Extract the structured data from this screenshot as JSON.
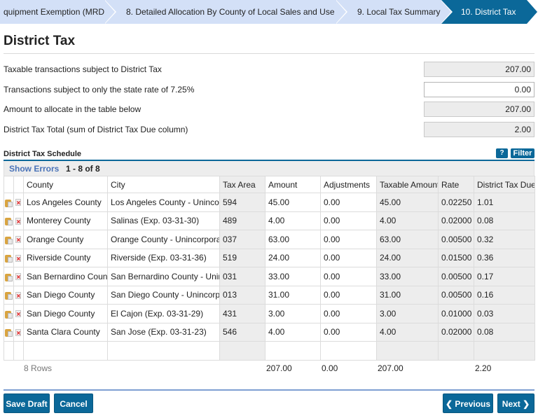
{
  "wizard": {
    "steps": [
      {
        "label": "quipment Exemption (MRD)",
        "active": false
      },
      {
        "label": "8. Detailed Allocation By County of Local Sales and Use Tax",
        "active": false
      },
      {
        "label": "9. Local Tax Summary",
        "active": false
      },
      {
        "label": "10. District Tax",
        "active": true
      }
    ]
  },
  "page": {
    "title": "District Tax"
  },
  "fields": [
    {
      "label": "Taxable transactions subject to District Tax",
      "value": "207.00",
      "editable": false
    },
    {
      "label": "Transactions subject to only the state rate of 7.25%",
      "value": "0.00",
      "editable": true
    },
    {
      "label": "Amount to allocate in the table below",
      "value": "207.00",
      "editable": false
    },
    {
      "label": "District Tax Total (sum of District Tax Due column)",
      "value": "2.00",
      "editable": false
    }
  ],
  "schedule": {
    "title": "District Tax Schedule",
    "help_label": "?",
    "filter_label": "Filter",
    "show_errors_label": "Show Errors",
    "paging": "1 - 8 of 8",
    "columns": [
      "County",
      "City",
      "Tax Area",
      "Amount",
      "Adjustments",
      "Taxable Amount",
      "Rate",
      "District Tax Due"
    ],
    "rows": [
      {
        "county": "Los Angeles County",
        "city": "Los Angeles County - Unincorpo",
        "tax_area": "594",
        "amount": "45.00",
        "adjustments": "0.00",
        "taxable_amount": "45.00",
        "rate": "0.02250",
        "due": "1.01"
      },
      {
        "county": "Monterey County",
        "city": "Salinas (Exp. 03-31-30)",
        "tax_area": "489",
        "amount": "4.00",
        "adjustments": "0.00",
        "taxable_amount": "4.00",
        "rate": "0.02000",
        "due": "0.08"
      },
      {
        "county": "Orange County",
        "city": "Orange County - Unincorporate",
        "tax_area": "037",
        "amount": "63.00",
        "adjustments": "0.00",
        "taxable_amount": "63.00",
        "rate": "0.00500",
        "due": "0.32"
      },
      {
        "county": "Riverside County",
        "city": "Riverside (Exp. 03-31-36)",
        "tax_area": "519",
        "amount": "24.00",
        "adjustments": "0.00",
        "taxable_amount": "24.00",
        "rate": "0.01500",
        "due": "0.36"
      },
      {
        "county": "San Bernardino County",
        "city": "San Bernardino County - Uninco",
        "tax_area": "031",
        "amount": "33.00",
        "adjustments": "0.00",
        "taxable_amount": "33.00",
        "rate": "0.00500",
        "due": "0.17"
      },
      {
        "county": "San Diego County",
        "city": "San Diego County - Unincorpora",
        "tax_area": "013",
        "amount": "31.00",
        "adjustments": "0.00",
        "taxable_amount": "31.00",
        "rate": "0.00500",
        "due": "0.16"
      },
      {
        "county": "San Diego County",
        "city": "El Cajon (Exp. 03-31-29)",
        "tax_area": "431",
        "amount": "3.00",
        "adjustments": "0.00",
        "taxable_amount": "3.00",
        "rate": "0.01000",
        "due": "0.03"
      },
      {
        "county": "Santa Clara County",
        "city": "San Jose (Exp. 03-31-23)",
        "tax_area": "546",
        "amount": "4.00",
        "adjustments": "0.00",
        "taxable_amount": "4.00",
        "rate": "0.02000",
        "due": "0.08"
      }
    ],
    "totals": {
      "rows_label": "8 Rows",
      "amount": "207.00",
      "adjustments": "0.00",
      "taxable_amount": "207.00",
      "due": "2.20"
    }
  },
  "actions": {
    "save_draft": "Save Draft",
    "cancel": "Cancel",
    "previous": "Previous",
    "next": "Next"
  },
  "colors": {
    "accent": "#0b6899",
    "step_inactive": "#d3e0f7",
    "link": "#4a73b8",
    "delete_icon": "#e0191b"
  }
}
